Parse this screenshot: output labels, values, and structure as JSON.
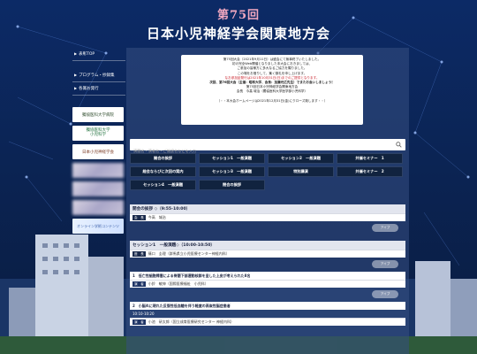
{
  "header": {
    "edition": "第75回",
    "title": "日本小児神経学会関東地方会"
  },
  "sidebar": {
    "links": [
      {
        "arrow": "▶",
        "label": "表彰TOP"
      },
      {
        "arrow": "▶",
        "label": "プログラム・抄録集"
      },
      {
        "arrow": "▶",
        "label": "各賞お発行"
      }
    ],
    "banners": [
      {
        "label": "獨協医科大学病院"
      },
      {
        "label_top": "獨協医科大学",
        "label_bottom": "小児科学"
      },
      {
        "label": "日本小児神経学会"
      },
      {
        "label": ""
      },
      {
        "label": ""
      },
      {
        "label": ""
      },
      {
        "label": "オンライン学術コンテンツ"
      }
    ]
  },
  "notice": {
    "lines": [
      "第75回大会（2021年9月11日）は盛会にて無事終了いたしました。",
      "初の完全Web開催となりました本大会におきましては、",
      "ご参加の皆様方に多大なるご協力を賜りました。",
      "この場をお借りして、篤く御礼を申し上げます。",
      "なお参加証発行は2021年10月31日(日)までのご提供となります。",
      "次回、第76回大会（主催：昭和大学、会長：加藤光広先生）でまたお会いしましょう！",
      "",
      "第75回日本小児神経学会関東地方会",
      "会長　今高 城治（獨協医科大学医学部小児科学）",
      "",
      "（・・本大会ホームページは2021年12月31日(金)にクローズ致します・・）"
    ]
  },
  "search": {
    "placeholder": "演題名・演者名・ご施設名などを入力"
  },
  "nav": {
    "rows": [
      [
        "開会の挨拶",
        "セッション1　一般演題",
        "セッション2　一般演題",
        "共催セミナー　1"
      ],
      [
        "総会ならびに次回の案内",
        "セッション3　一般演題",
        "特別講演",
        "共催セミナー　2"
      ],
      [
        "セッション4　一般演題",
        "閉会の挨拶"
      ]
    ]
  },
  "sessions": {
    "opening": {
      "title": "開会の挨拶 ◇（9:55-10:00）",
      "role_tag": "会　長",
      "person": "今高　城治",
      "more": "アイブ"
    },
    "session1": {
      "title": "セッション1　一般演題◇（10:00-10:50）",
      "chair_tag": "座　長",
      "chair": "篠口　圭理（群馬県立小児医療センター神経内科）",
      "more": "アイブ",
      "talk1_title": "1　低亡性細胞障害による脊髄下部運動核群を呈した上皮が考えられた8名",
      "talk1_tag": "演　者",
      "talk1_person": "小鈴　敏伸（国際医療福祉　小児科）",
      "talk2_title": "2　小脳炎に現れた反復性低血糖を伴う軽度の高炭性脳症患者",
      "time": "10:10-10:20",
      "talk2_tag": "演　者",
      "talk2_person": "小池　研太郎（国立成育医療研究センター 神経内科）"
    }
  },
  "colors": {
    "background": "#0b2454",
    "accent": "#f2a8c0",
    "nav_button": "#11233f"
  }
}
